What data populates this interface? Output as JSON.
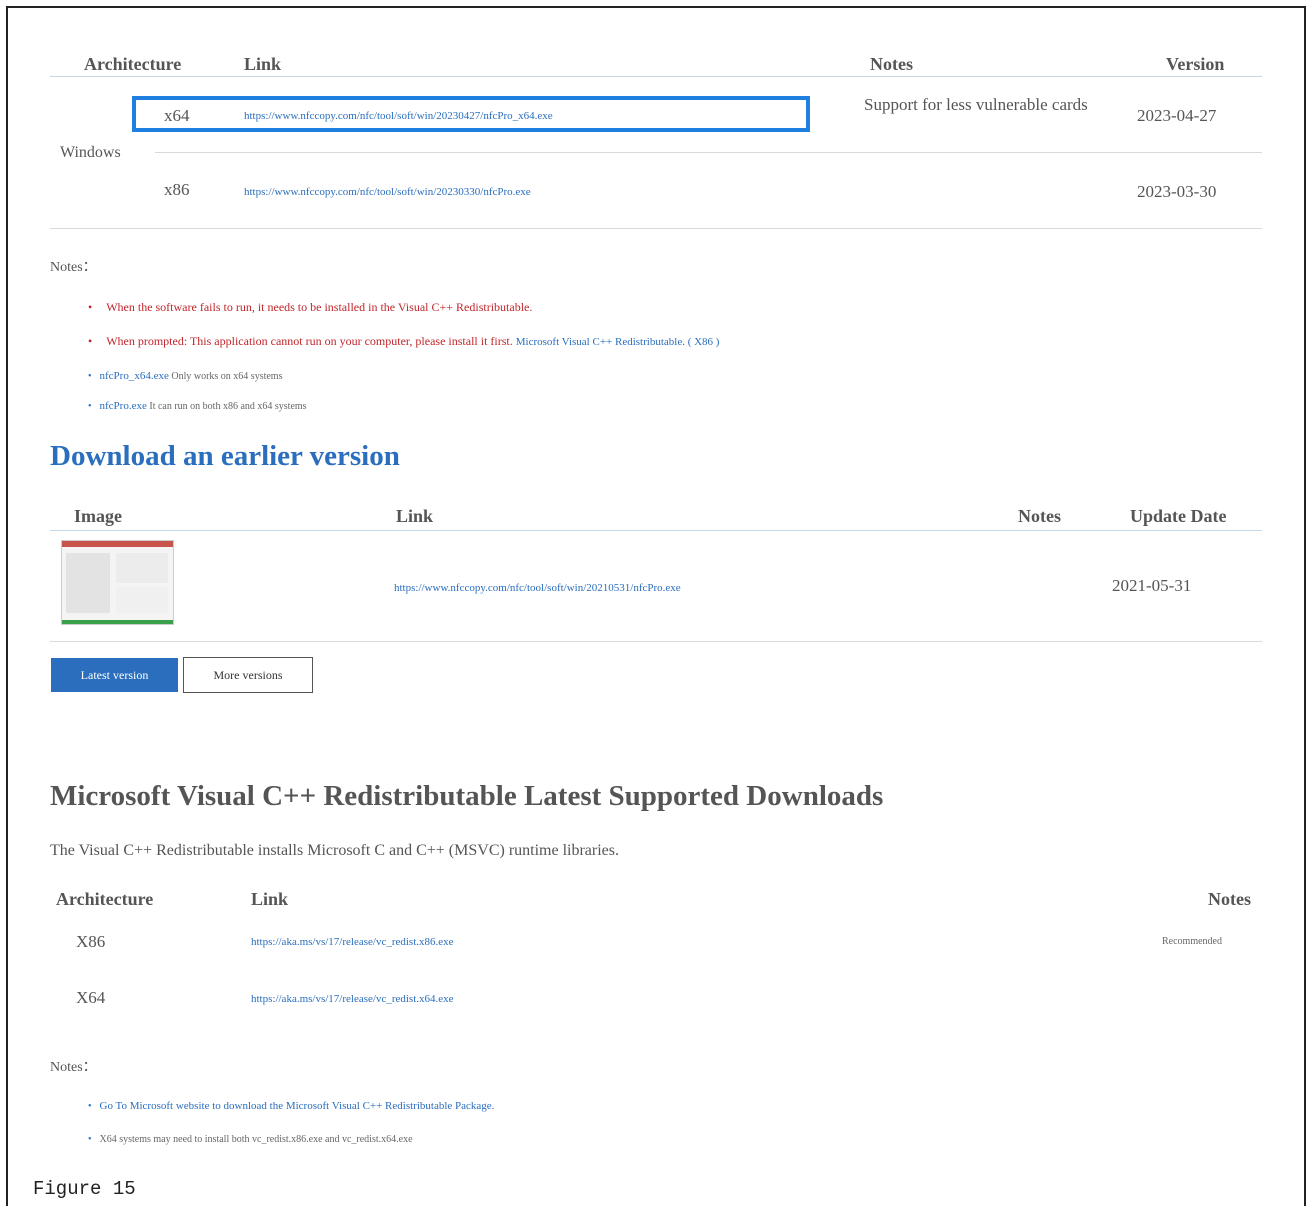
{
  "top_table": {
    "headers": {
      "architecture": "Architecture",
      "link": "Link",
      "notes": "Notes",
      "version": "Version"
    },
    "platform": "Windows",
    "rows": [
      {
        "arch": "x64",
        "link": "https://www.nfccopy.com/nfc/tool/soft/win/20230427/nfcPro_x64.exe",
        "notes": "Support for less vulnerable cards",
        "version": "2023-04-27"
      },
      {
        "arch": "x86",
        "link": "https://www.nfccopy.com/nfc/tool/soft/win/20230330/nfcPro.exe",
        "notes": "",
        "version": "2023-03-30"
      }
    ]
  },
  "notes1": {
    "label": "Notes：",
    "items": [
      {
        "text": "When the software fails to run, it needs to be installed in the Visual C++ Redistributable."
      },
      {
        "text": "When prompted: This application cannot run on your computer, please install it first.",
        "link": "Microsoft Visual C++ Redistributable. ( X86 )"
      },
      {
        "link": "nfcPro_x64.exe",
        "text": "Only works on x64 systems"
      },
      {
        "link": "nfcPro.exe",
        "text": "It can run on both x86 and x64 systems"
      }
    ]
  },
  "earlier": {
    "heading": "Download an earlier version",
    "headers": {
      "image": "Image",
      "link": "Link",
      "notes": "Notes",
      "date": "Update Date"
    },
    "row": {
      "link": "https://www.nfccopy.com/nfc/tool/soft/win/20210531/nfcPro.exe",
      "date": "2021-05-31"
    },
    "buttons": {
      "latest": "Latest version",
      "more": "More versions"
    }
  },
  "msvc": {
    "heading": "Microsoft Visual C++ Redistributable Latest Supported Downloads",
    "desc": "The Visual C++ Redistributable installs Microsoft C and C++ (MSVC) runtime libraries.",
    "headers": {
      "architecture": "Architecture",
      "link": "Link",
      "notes": "Notes"
    },
    "rows": [
      {
        "arch": "X86",
        "link": "https://aka.ms/vs/17/release/vc_redist.x86.exe",
        "notes": "Recommended"
      },
      {
        "arch": "X64",
        "link": "https://aka.ms/vs/17/release/vc_redist.x64.exe",
        "notes": ""
      }
    ]
  },
  "notes2": {
    "label": "Notes：",
    "items": [
      {
        "link": "Go To Microsoft website to download the Microsoft Visual C++ Redistributable Package."
      },
      {
        "text": "X64 systems may need to install both vc_redist.x86.exe and vc_redist.x64.exe"
      }
    ]
  },
  "caption": "Figure 15"
}
